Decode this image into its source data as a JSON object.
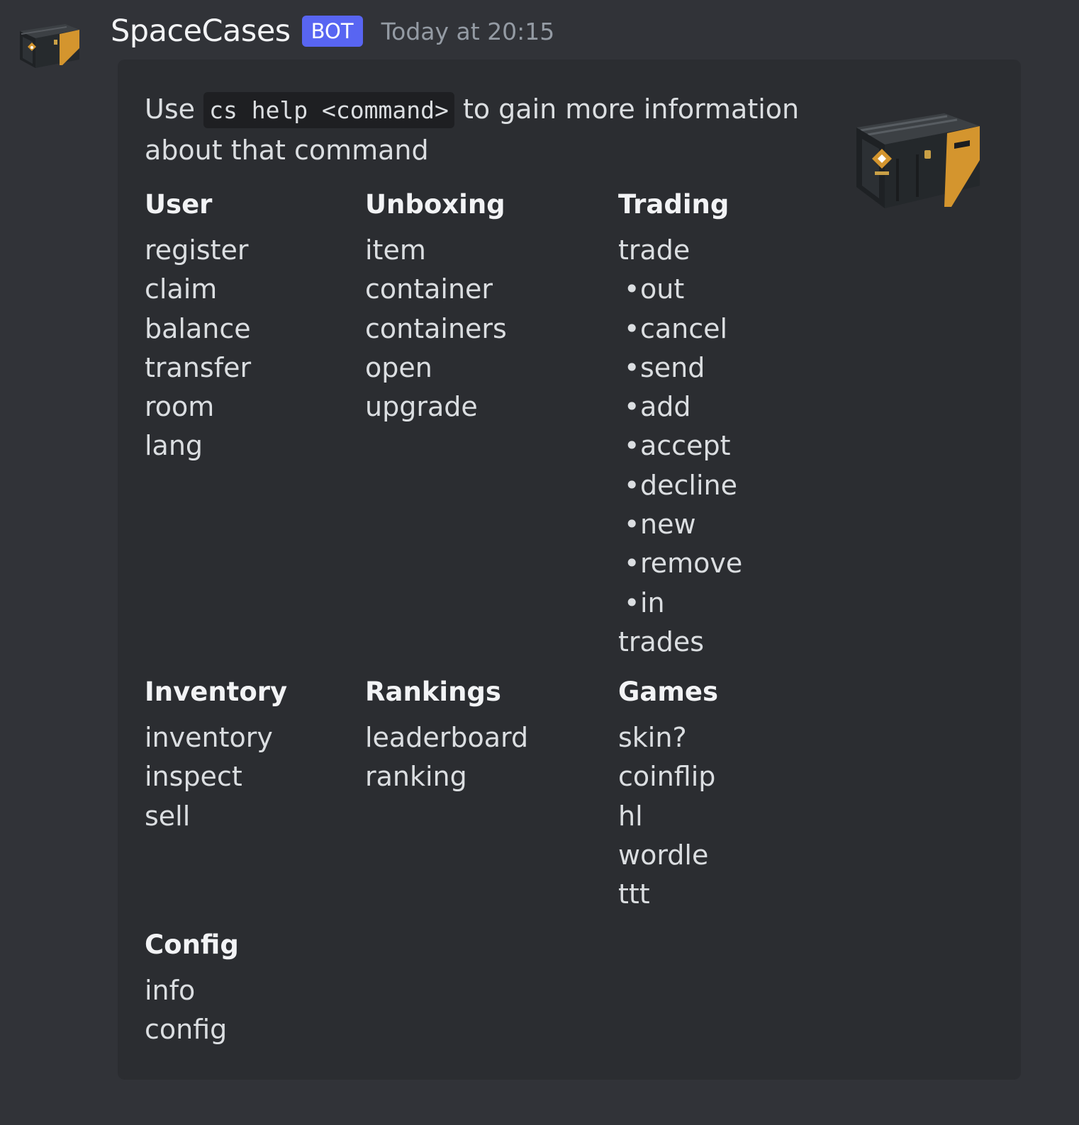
{
  "message": {
    "username": "SpaceCases",
    "badge": "BOT",
    "timestamp": "Today at 20:15"
  },
  "embed": {
    "description": {
      "prefix": "Use",
      "code": "cs help <command>",
      "suffix": "to gain more information about that command"
    },
    "fields": [
      {
        "name": "User",
        "items": [
          {
            "text": "register",
            "bullet": false
          },
          {
            "text": "claim",
            "bullet": false
          },
          {
            "text": "balance",
            "bullet": false
          },
          {
            "text": "transfer",
            "bullet": false
          },
          {
            "text": "room",
            "bullet": false
          },
          {
            "text": "lang",
            "bullet": false
          }
        ]
      },
      {
        "name": "Unboxing",
        "items": [
          {
            "text": "item",
            "bullet": false
          },
          {
            "text": "container",
            "bullet": false
          },
          {
            "text": "containers",
            "bullet": false
          },
          {
            "text": "open",
            "bullet": false
          },
          {
            "text": "upgrade",
            "bullet": false
          }
        ]
      },
      {
        "name": "Trading",
        "items": [
          {
            "text": "trade",
            "bullet": false
          },
          {
            "text": "out",
            "bullet": true
          },
          {
            "text": "cancel",
            "bullet": true
          },
          {
            "text": "send",
            "bullet": true
          },
          {
            "text": "add",
            "bullet": true
          },
          {
            "text": "accept",
            "bullet": true
          },
          {
            "text": "decline",
            "bullet": true
          },
          {
            "text": "new",
            "bullet": true
          },
          {
            "text": "remove",
            "bullet": true
          },
          {
            "text": "in",
            "bullet": true
          },
          {
            "text": "trades",
            "bullet": false
          }
        ]
      },
      {
        "name": "Inventory",
        "items": [
          {
            "text": "inventory",
            "bullet": false
          },
          {
            "text": "inspect",
            "bullet": false
          },
          {
            "text": "sell",
            "bullet": false
          }
        ]
      },
      {
        "name": "Rankings",
        "items": [
          {
            "text": "leaderboard",
            "bullet": false
          },
          {
            "text": "ranking",
            "bullet": false
          }
        ]
      },
      {
        "name": "Games",
        "items": [
          {
            "text": "skin?",
            "bullet": false
          },
          {
            "text": "coinflip",
            "bullet": false
          },
          {
            "text": "hl",
            "bullet": false
          },
          {
            "text": "wordle",
            "bullet": false
          },
          {
            "text": "ttt",
            "bullet": false
          }
        ]
      },
      {
        "name": "Config",
        "items": [
          {
            "text": "info",
            "bullet": false
          },
          {
            "text": "config",
            "bullet": false
          }
        ]
      }
    ],
    "bullet_glyph": "•"
  },
  "icons": {
    "avatar": "weapon-case-icon",
    "thumbnail": "weapon-case-icon"
  },
  "colors": {
    "background": "#313338",
    "embed_background": "#2b2d31",
    "badge": "#5865f2",
    "username": "#f2f3f5",
    "timestamp": "#949ba4",
    "text": "#dbdee1",
    "case_accent": "#d4952e"
  }
}
